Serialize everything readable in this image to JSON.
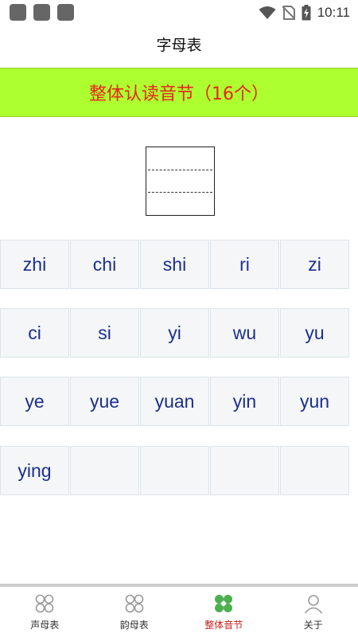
{
  "status_bar": {
    "time": "10:11"
  },
  "header": {
    "title": "字母表"
  },
  "banner": {
    "text": "整体认读音节（16个）",
    "bg_color": "#adff2f",
    "text_color": "#e8241c"
  },
  "syllables": [
    [
      "zhi",
      "chi",
      "shi",
      "ri",
      "zi"
    ],
    [
      "ci",
      "si",
      "yi",
      "wu",
      "yu"
    ],
    [
      "ye",
      "yue",
      "yuan",
      "yin",
      "yun"
    ],
    [
      "ying",
      "",
      "",
      "",
      ""
    ]
  ],
  "nav": {
    "active_index": 2,
    "active_color": "#c81f1f",
    "items": [
      {
        "label": "声母表",
        "icon": "four-circles-icon"
      },
      {
        "label": "韵母表",
        "icon": "four-circles-icon"
      },
      {
        "label": "整体音节",
        "icon": "four-circles-filled-icon"
      },
      {
        "label": "关于",
        "icon": "person-icon"
      }
    ]
  }
}
